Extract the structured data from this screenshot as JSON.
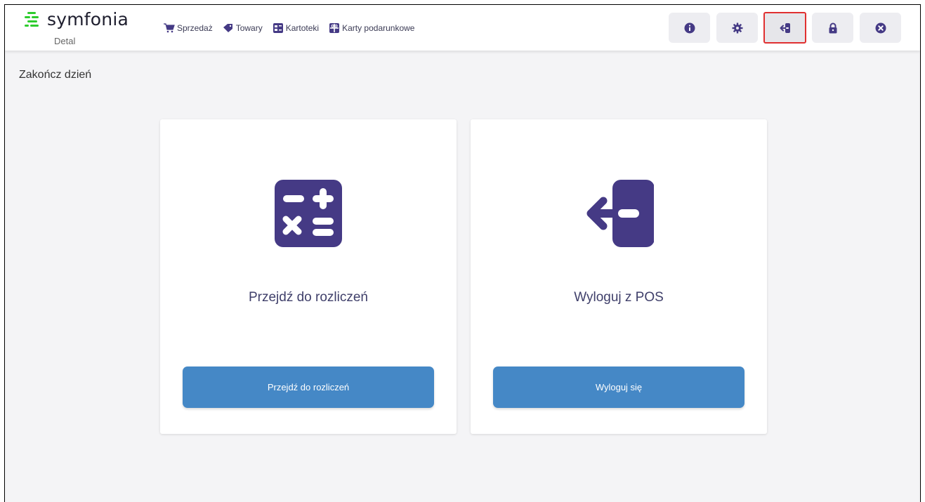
{
  "app": {
    "name": "symfonia",
    "subtitle": "Detal"
  },
  "nav": {
    "items": [
      {
        "label": "Sprzedaż",
        "icon": "cart-icon"
      },
      {
        "label": "Towary",
        "icon": "tag-icon"
      },
      {
        "label": "Kartoteki",
        "icon": "card-index-icon"
      },
      {
        "label": "Karty podarunkowe",
        "icon": "gift-card-icon"
      }
    ]
  },
  "toolbar": {
    "buttons": [
      {
        "icon": "info-icon"
      },
      {
        "icon": "gear-icon"
      },
      {
        "icon": "logout-icon",
        "active": true
      },
      {
        "icon": "lock-icon"
      },
      {
        "icon": "close-circle-icon"
      }
    ]
  },
  "page": {
    "title": "Zakończ dzień"
  },
  "cards": [
    {
      "title": "Przejdź do rozliczeń",
      "button_label": "Przejdź do rozliczeń",
      "icon": "calculator-icon"
    },
    {
      "title": "Wyloguj z POS",
      "button_label": "Wyloguj się",
      "icon": "logout-icon"
    }
  ],
  "colors": {
    "brand_green": "#2ecc2e",
    "accent_purple": "#453a85",
    "button_blue": "#4588c6",
    "active_outline": "#e03030"
  }
}
